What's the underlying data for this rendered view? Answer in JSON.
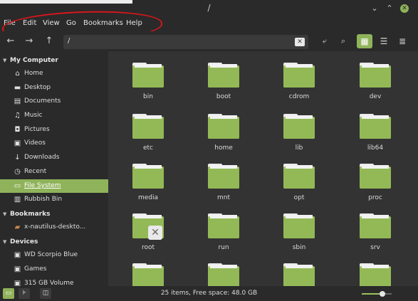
{
  "window": {
    "title": "/"
  },
  "menubar": {
    "items": [
      "File",
      "Edit",
      "View",
      "Go",
      "Bookmarks",
      "Help"
    ]
  },
  "toolbar": {
    "location": "/",
    "icons": [
      "back-icon",
      "forward-icon",
      "up-icon",
      "clear-icon",
      "toggle-location-icon",
      "search-icon",
      "icon-view-icon",
      "list-view-icon",
      "compact-view-icon"
    ]
  },
  "sidebar": {
    "sections": [
      {
        "label": "My Computer",
        "items": [
          {
            "label": "Home",
            "icon": "home-icon"
          },
          {
            "label": "Desktop",
            "icon": "desktop-icon"
          },
          {
            "label": "Documents",
            "icon": "documents-icon"
          },
          {
            "label": "Music",
            "icon": "music-icon"
          },
          {
            "label": "Pictures",
            "icon": "pictures-icon"
          },
          {
            "label": "Videos",
            "icon": "videos-icon"
          },
          {
            "label": "Downloads",
            "icon": "downloads-icon"
          },
          {
            "label": "Recent",
            "icon": "recent-icon"
          },
          {
            "label": "File System",
            "icon": "file-system-icon",
            "active": true
          },
          {
            "label": "Rubbish Bin",
            "icon": "trash-icon"
          }
        ]
      },
      {
        "label": "Bookmarks",
        "items": [
          {
            "label": "x-nautilus-deskto...",
            "icon": "bookmark-folder-icon"
          }
        ]
      },
      {
        "label": "Devices",
        "items": [
          {
            "label": "WD Scorpio Blue",
            "icon": "drive-icon"
          },
          {
            "label": "Games",
            "icon": "drive-icon"
          },
          {
            "label": "315 GB Volume",
            "icon": "drive-icon"
          }
        ]
      }
    ]
  },
  "folders": [
    "bin",
    "boot",
    "cdrom",
    "dev",
    "etc",
    "home",
    "lib",
    "lib64",
    "media",
    "mnt",
    "opt",
    "proc",
    "root",
    "run",
    "sbin",
    "srv",
    "",
    "",
    "",
    ""
  ],
  "statusbar": {
    "text": "25 items, Free space: 48.0 GB",
    "zoom_fraction": 0.7
  },
  "colors": {
    "accent": "#8fb35a",
    "folder": "#9cc15e",
    "annotation": "#d9161c"
  }
}
